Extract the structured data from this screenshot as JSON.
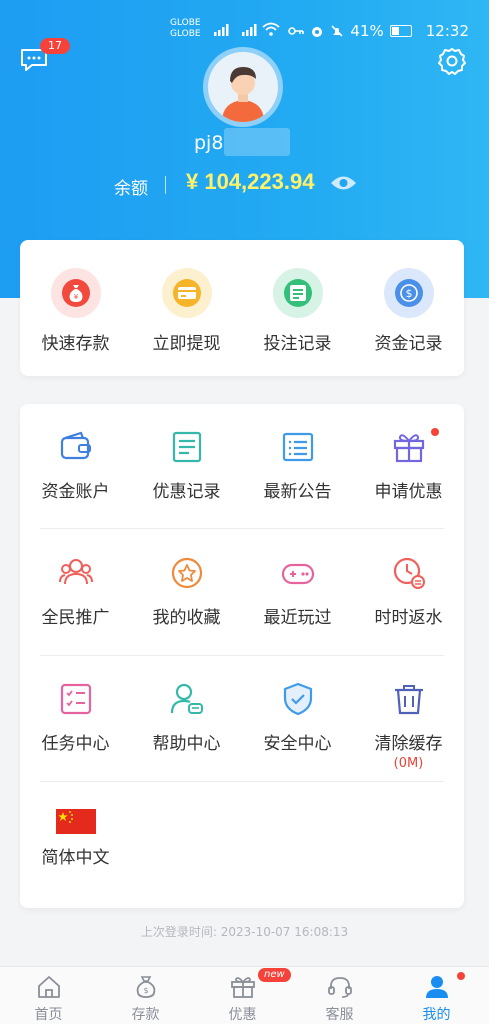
{
  "status_bar": {
    "carrier1": "GLOBE",
    "carrier2": "GLOBE",
    "battery": "41%",
    "time": "12:32"
  },
  "header": {
    "message_badge": "17",
    "username": "pj8",
    "balance_label": "余额",
    "balance_value": "¥ 104,223.94"
  },
  "quick_actions": [
    {
      "label": "快速存款",
      "icon": "money-bag-icon",
      "color": "#f2493f",
      "bg": "#fde3e1"
    },
    {
      "label": "立即提现",
      "icon": "card-icon",
      "color": "#f6b42a",
      "bg": "#fdf0cf"
    },
    {
      "label": "投注记录",
      "icon": "list-icon",
      "color": "#34c07a",
      "bg": "#d7f3e5"
    },
    {
      "label": "资金记录",
      "icon": "dollar-coin-icon",
      "color": "#4a8fe8",
      "bg": "#dbe8fb"
    }
  ],
  "grid": {
    "row1": [
      {
        "label": "资金账户",
        "icon": "wallet-icon",
        "color": "#3f7fe0"
      },
      {
        "label": "优惠记录",
        "icon": "document-icon",
        "color": "#35b8a9"
      },
      {
        "label": "最新公告",
        "icon": "announcement-icon",
        "color": "#3f9be8"
      },
      {
        "label": "申请优惠",
        "icon": "gift-icon",
        "color": "#7367e0"
      }
    ],
    "row2": [
      {
        "label": "全民推广",
        "icon": "users-icon",
        "color": "#f0605a"
      },
      {
        "label": "我的收藏",
        "icon": "star-icon",
        "color": "#ef8a3c"
      },
      {
        "label": "最近玩过",
        "icon": "gamepad-icon",
        "color": "#e5639e"
      },
      {
        "label": "时时返水",
        "icon": "clock-icon",
        "color": "#f0605a"
      }
    ],
    "row3": [
      {
        "label": "任务中心",
        "icon": "task-icon",
        "color": "#e5639e"
      },
      {
        "label": "帮助中心",
        "icon": "help-user-icon",
        "color": "#35b8a9"
      },
      {
        "label": "安全中心",
        "icon": "shield-icon",
        "color": "#3f9be8"
      },
      {
        "label": "清除缓存",
        "icon": "trash-icon",
        "color": "#5061b8",
        "sub": "(0M)"
      }
    ],
    "language": {
      "label": "简体中文",
      "icon": "china-flag-icon"
    }
  },
  "last_login": "上次登录时间:  2023-10-07 16:08:13",
  "tabbar": {
    "items": [
      {
        "label": "首页",
        "icon": "home-icon"
      },
      {
        "label": "存款",
        "icon": "money-bag-icon"
      },
      {
        "label": "优惠",
        "icon": "gift-icon"
      },
      {
        "label": "客服",
        "icon": "headset-icon"
      },
      {
        "label": "我的",
        "icon": "user-icon"
      }
    ],
    "active_index": 4,
    "new_badge": "new"
  }
}
